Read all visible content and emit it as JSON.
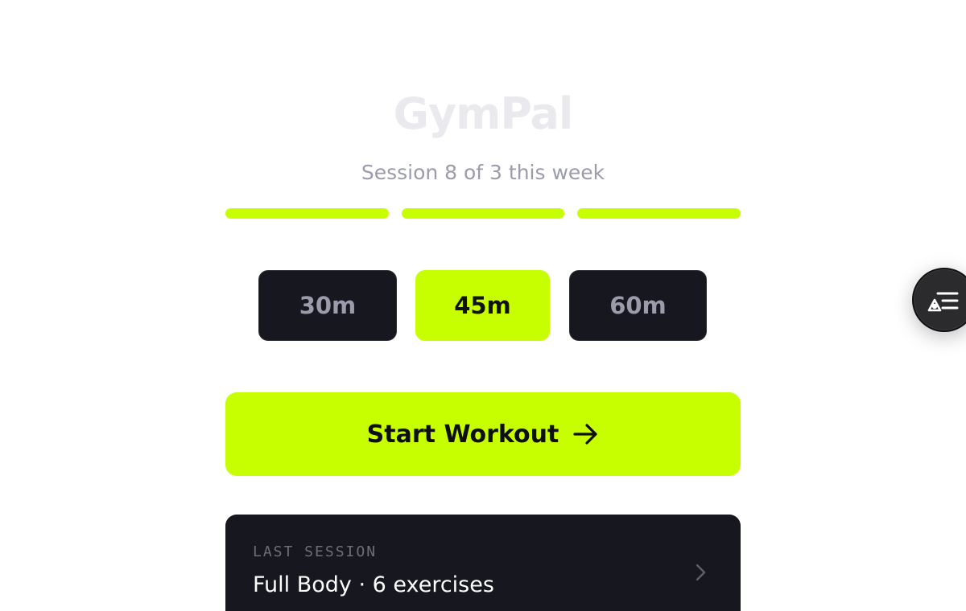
{
  "app": {
    "title": "GymPal",
    "session_text": "Session 8 of 3 this week"
  },
  "weekly_progress": {
    "segments": 3,
    "completed": 3,
    "accent_color": "#c8ff00"
  },
  "durations": {
    "options": [
      "30m",
      "45m",
      "60m"
    ],
    "selected": "45m"
  },
  "start_button": {
    "label": "Start Workout",
    "icon": "arrow-right-icon"
  },
  "last_session": {
    "label": "LAST SESSION",
    "summary": "Full Body · 6 exercises",
    "icon": "chevron-right-icon"
  },
  "floating_button": {
    "icon": "shapes-list-icon"
  },
  "colors": {
    "accent": "#c8ff00",
    "dark_surface": "#16171f",
    "muted_text": "#9b9bab",
    "title_text": "#e9e9ee"
  }
}
